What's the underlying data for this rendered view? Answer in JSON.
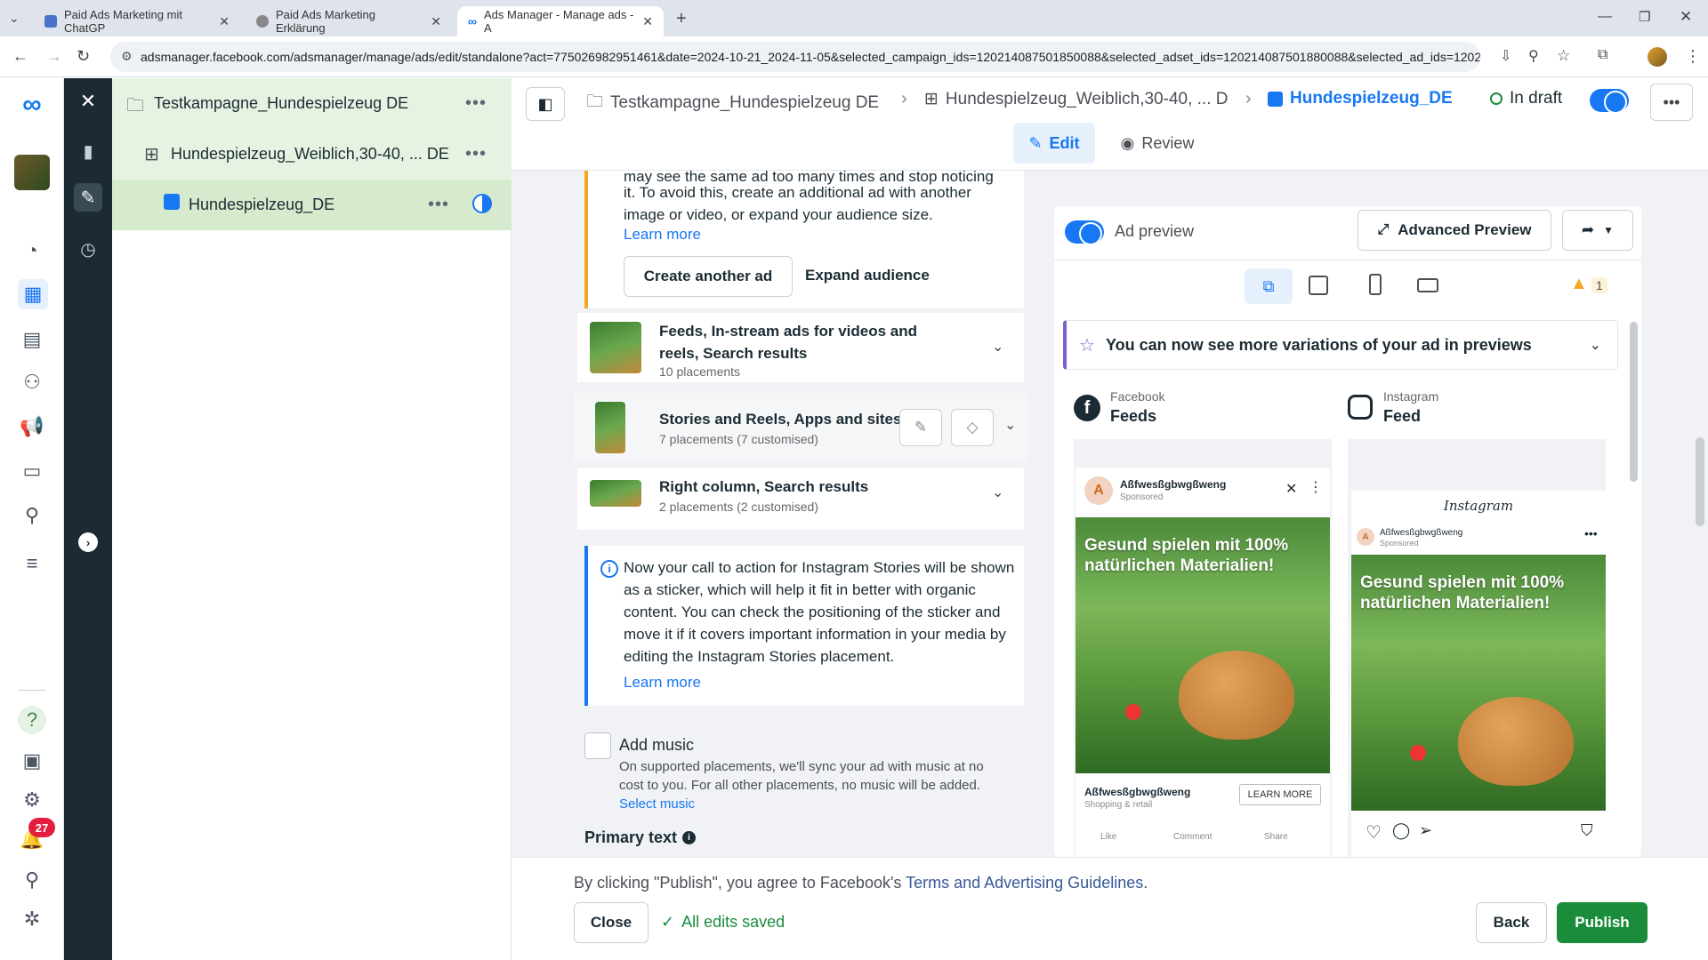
{
  "browser": {
    "tabs": [
      {
        "title": "Paid Ads Marketing mit ChatGP"
      },
      {
        "title": "Paid Ads Marketing Erklärung"
      },
      {
        "title": "Ads Manager - Manage ads - A"
      }
    ],
    "url": "adsmanager.facebook.com/adsmanager/manage/ads/edit/standalone?act=775026982951461&date=2024-10-21_2024-11-05&selected_campaign_ids=120214087501850088&selected_adset_ids=120214087501880088&selected_ad_ids=120214..."
  },
  "rail": {
    "notification_count": "27"
  },
  "tree": {
    "campaign": "Testkampagne_Hundespielzeug DE",
    "adset": "Hundespielzeug_Weiblich,30-40, ... DE",
    "ad": "Hundespielzeug_DE"
  },
  "breadcrumb": {
    "campaign": "Testkampagne_Hundespielzeug DE",
    "adset": "Hundespielzeug_Weiblich,30-40, ... D",
    "ad": "Hundespielzeug_DE",
    "status": "In draft"
  },
  "modes": {
    "edit": "Edit",
    "review": "Review"
  },
  "warning": {
    "text_partial": "may see the same ad too many times and stop noticing",
    "text": "it. To avoid this, create an additional ad with another image or video, or expand your audience size.",
    "learn_more": "Learn more",
    "create_btn": "Create another ad",
    "expand_btn": "Expand audience"
  },
  "placements": [
    {
      "title": "Feeds, In-stream ads for videos and reels, Search results",
      "sub": "10 placements"
    },
    {
      "title": "Stories and Reels, Apps and sites",
      "sub": "7 placements (7 customised)"
    },
    {
      "title": "Right column, Search results",
      "sub": "2 placements (2 customised)"
    }
  ],
  "info": {
    "text": "Now your call to action for Instagram Stories will be shown as a sticker, which will help it fit in better with organic content. You can check the positioning of the sticker and move it if it covers important information in your media by editing the Instagram Stories placement.",
    "learn_more": "Learn more"
  },
  "music": {
    "label": "Add music",
    "desc": "On supported placements, we'll sync your ad with music at no cost to you. For all other placements, no music will be added.",
    "link": "Select music"
  },
  "primary_text": {
    "label": "Primary text"
  },
  "preview": {
    "toggle_label": "Ad preview",
    "advanced": "Advanced Preview",
    "warning_count": "1",
    "banner": "You can now see more variations of your ad in previews",
    "fb": {
      "platform": "Facebook",
      "placement": "Feeds"
    },
    "ig": {
      "platform": "Instagram",
      "placement": "Feed",
      "logo": "Instagram"
    },
    "ad": {
      "page": "Aßfwesßgbwgßweng",
      "sponsored": "Sponsored",
      "headline": "Gesund spielen mit 100% natürlichen Materialien!",
      "category": "Shopping & retail",
      "cta": "LEARN MORE",
      "like": "Like",
      "comment": "Comment",
      "share": "Share"
    }
  },
  "footer": {
    "notice_prefix": "By clicking \"Publish\", you agree to Facebook's",
    "notice_link": "Terms and Advertising Guidelines",
    "notice_suffix": ".",
    "close": "Close",
    "saved": "All edits saved",
    "back": "Back",
    "publish": "Publish"
  },
  "colors": {
    "accent": "#1877f2",
    "publish": "#1a8c3a",
    "warning": "#f5a623",
    "tree_selected": "#e7f3e2",
    "dark_rail": "#1c2b33"
  }
}
